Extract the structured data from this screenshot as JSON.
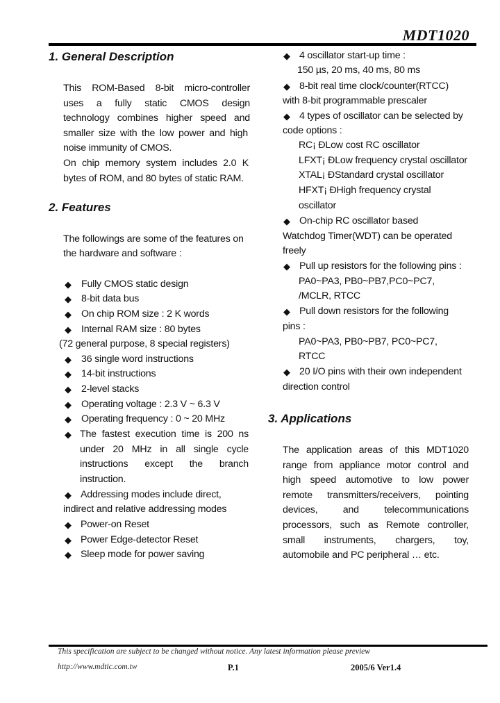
{
  "header": {
    "doc_title": "MDT1020"
  },
  "section1": {
    "heading": "1. General Description",
    "lines": [
      "This ROM-Based 8-bit micro-controller",
      "uses a fully static CMOS design",
      "technology combines higher speed and",
      "smaller size with the low power and high",
      "noise immunity of CMOS.",
      "On chip memory system includes 2.0 K",
      "bytes of ROM, and 80 bytes of static RAM."
    ]
  },
  "section2": {
    "heading": "2. Features",
    "intro": [
      "The followings are some of the features on",
      "the hardware and software :"
    ],
    "items": [
      "Fully CMOS static design",
      "8-bit data bus",
      "On chip ROM size : 2 K words",
      "Internal RAM size : 80 bytes",
      "(72 general purpose, 8 special registers)",
      "36 single word instructions",
      "14-bit instructions",
      "2-level stacks",
      "Operating voltage : 2.3 V ~ 6.3 V",
      "Operating frequency : 0 ~ 20 MHz",
      "The fastest execution time is 200 ns",
      "under 20 MHz in all single cycle",
      "instructions except the branch",
      "instruction.",
      "Addressing modes include direct,",
      "indirect and relative addressing modes",
      "Power-on Reset",
      "Power Edge-detector Reset",
      "Sleep mode for power saving"
    ],
    "right_items": [
      "4 oscillator start-up time :",
      "150 µs, 20 ms, 40 ms, 80 ms",
      "8-bit real time clock/counter(RTCC)",
      "with 8-bit programmable prescaler",
      "4 types of oscillator can be selected by",
      "code options :",
      "RC¡ ÐLow cost RC oscillator",
      "LFXT¡ ÐLow frequency crystal oscillator",
      "XTAL¡ ÐStandard crystal oscillator",
      "HFXT¡ ÐHigh frequency crystal",
      "oscillator",
      "On-chip RC oscillator based",
      "Watchdog Timer(WDT) can be operated",
      "freely",
      "Pull up resistors for the following pins :",
      "PA0~PA3, PB0~PB7,PC0~PC7,",
      "/MCLR, RTCC",
      "Pull down resistors for the following",
      "pins :",
      "PA0~PA3, PB0~PB7, PC0~PC7,",
      "RTCC",
      "20 I/O pins with their own independent",
      "direction control"
    ]
  },
  "section3": {
    "heading": "3. Applications",
    "lines": [
      "The application areas of this MDT1020",
      "range from appliance motor control and",
      "high speed automotive to low power",
      "remote transmitters/receivers, pointing",
      "devices, and telecommunications",
      "processors, such as Remote controller,",
      "small instruments, chargers, toy,",
      "automobile and PC peripheral … etc."
    ]
  },
  "footer": {
    "notice": "This specification are subject to be changed without notice. Any latest information  please preview",
    "url": "http://www.mdtic.com.tw",
    "page": "P.1",
    "version": "2005/6 Ver1.4"
  },
  "icons": {
    "bullet": "◆"
  }
}
